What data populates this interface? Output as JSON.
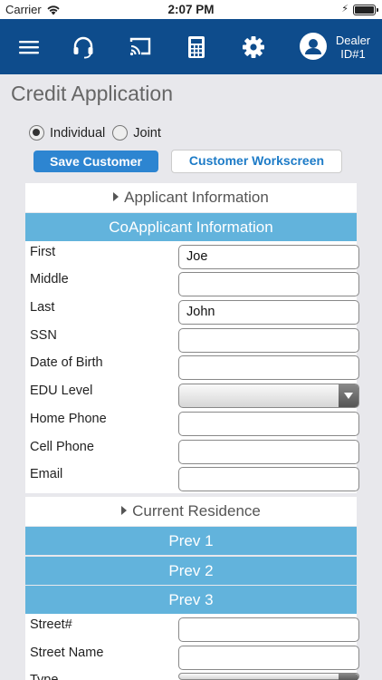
{
  "status_bar": {
    "carrier": "Carrier",
    "time": "2:07 PM"
  },
  "nav": {
    "dealer_label": "Dealer",
    "dealer_id": "ID#1",
    "icons": [
      "menu-icon",
      "headset-icon",
      "cast-icon",
      "calculator-icon",
      "gear-icon",
      "user-icon"
    ]
  },
  "page_title": "Credit Application",
  "applicant_type": {
    "options": [
      "Individual",
      "Joint"
    ],
    "selected": "Individual"
  },
  "buttons": {
    "save_customer": "Save Customer",
    "customer_workscreen": "Customer Workscreen"
  },
  "sections": {
    "applicant_information": "Applicant Information",
    "coapplicant_information": "CoApplicant Information",
    "current_residence": "Current Residence",
    "prev1": "Prev 1",
    "prev2": "Prev 2",
    "prev3": "Prev 3"
  },
  "coapplicant_fields": [
    {
      "label": "First",
      "value": "Joe"
    },
    {
      "label": "Middle",
      "value": ""
    },
    {
      "label": "Last",
      "value": "John"
    },
    {
      "label": "SSN",
      "value": ""
    },
    {
      "label": "Date of Birth",
      "value": ""
    },
    {
      "label": "EDU Level",
      "value": ""
    },
    {
      "label": "Home Phone",
      "value": ""
    },
    {
      "label": "Cell Phone",
      "value": ""
    },
    {
      "label": "Email",
      "value": ""
    }
  ],
  "residence_fields": [
    {
      "label": "Street#",
      "value": ""
    },
    {
      "label": "Street Name",
      "value": ""
    },
    {
      "label": "Type",
      "value": ""
    }
  ]
}
